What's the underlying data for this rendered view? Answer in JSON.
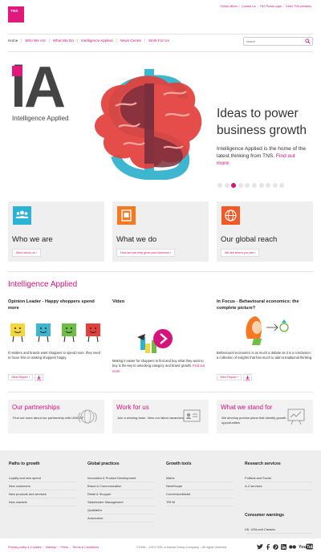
{
  "brand": {
    "logo": "TNS",
    "accent": "#e2197d"
  },
  "top_links": [
    "Global offices",
    "Contact Us",
    "TNS Portal Login",
    "Other TNS websites"
  ],
  "nav": [
    "Home",
    "Who We Are",
    "What We Do",
    "Intelligence Applied",
    "News Centre",
    "Work For Us"
  ],
  "search": {
    "placeholder": "search"
  },
  "hero": {
    "logo_text": "iA",
    "logo_caption": "Intelligence Applied",
    "heading": "Ideas to power business growth",
    "body": "Intelligence Applied is the home of the latest thinking from TNS.",
    "link": "Find out more",
    "slides": 10,
    "active_slide": 3
  },
  "cards": [
    {
      "title": "Who we are",
      "button": "More about us",
      "icon": "people-icon",
      "color": "#2ab3d5"
    },
    {
      "title": "What we do",
      "button": "How we can help grow your business",
      "icon": "document-icon",
      "color": "#f47920"
    },
    {
      "title": "Our global reach",
      "button": "We are where you are",
      "icon": "globe-icon",
      "color": "#f15a24"
    }
  ],
  "intelligence": {
    "heading": "Intelligence Applied",
    "opinion": {
      "title": "Opinion Leader - Happy shoppers spend more",
      "body": "If retailers and brands want shoppers to spend more, they need to focus first on making shoppers happy.",
      "button": "View Report"
    },
    "video": {
      "title": "Video",
      "body": "Making it easier for shoppers to find and buy what they want to buy is the key to unlocking category and brand growth.",
      "link": "Find out more."
    },
    "infocus": {
      "title": "In Focus - Behavioural economics: the complete picture?",
      "body": "Behavioural economics is as much a debate as it is a conclusion; a collection of insights that has much to add to traditional thinking.",
      "button": "View Report"
    }
  },
  "bottom_cards": [
    {
      "title": "Our partnerships",
      "body": "Find out more about our partnership with UNICEF",
      "icon": "unicef-icon"
    },
    {
      "title": "Work for us",
      "body": "Join a winning team. View our latest vacancies",
      "icon": "id-card-icon"
    },
    {
      "title": "What we stand for",
      "body": "We develop precise plans that identify growth opportunities",
      "icon": "presentation-icon"
    }
  ],
  "footer": {
    "columns": [
      {
        "heading": "Paths to growth",
        "items": [
          "Loyalty and new spend",
          "New customers",
          "New products and services",
          "New markets"
        ]
      },
      {
        "heading": "Global practices",
        "items": [
          "Innovation & Product Development",
          "Brand & Communication",
          "Retail & Shopper",
          "Stakeholder Management",
          "Qualitative",
          "Automotive"
        ]
      },
      {
        "heading": "Growth tools",
        "items": [
          "Matrix",
          "NeedScope",
          "ConversionModel",
          "TRI*M"
        ]
      },
      {
        "heading": "Research services",
        "items": [
          "Political and Social",
          "A-Z services"
        ]
      }
    ],
    "consumer": {
      "heading": "Consumer warnings",
      "items": [
        "UK, USA and Canada"
      ]
    },
    "bottom_links": [
      "Privacy policy & Cookies",
      "Sitemap",
      "Press",
      "Terms & Conditions"
    ],
    "copyright": "©1998 – 2013 TNS, a Kantar Group Company – All rights reserved",
    "social": [
      "twitter-icon",
      "facebook-icon",
      "pinterest-icon",
      "linkedin-icon",
      "flickr-icon",
      "youtube-icon"
    ]
  }
}
